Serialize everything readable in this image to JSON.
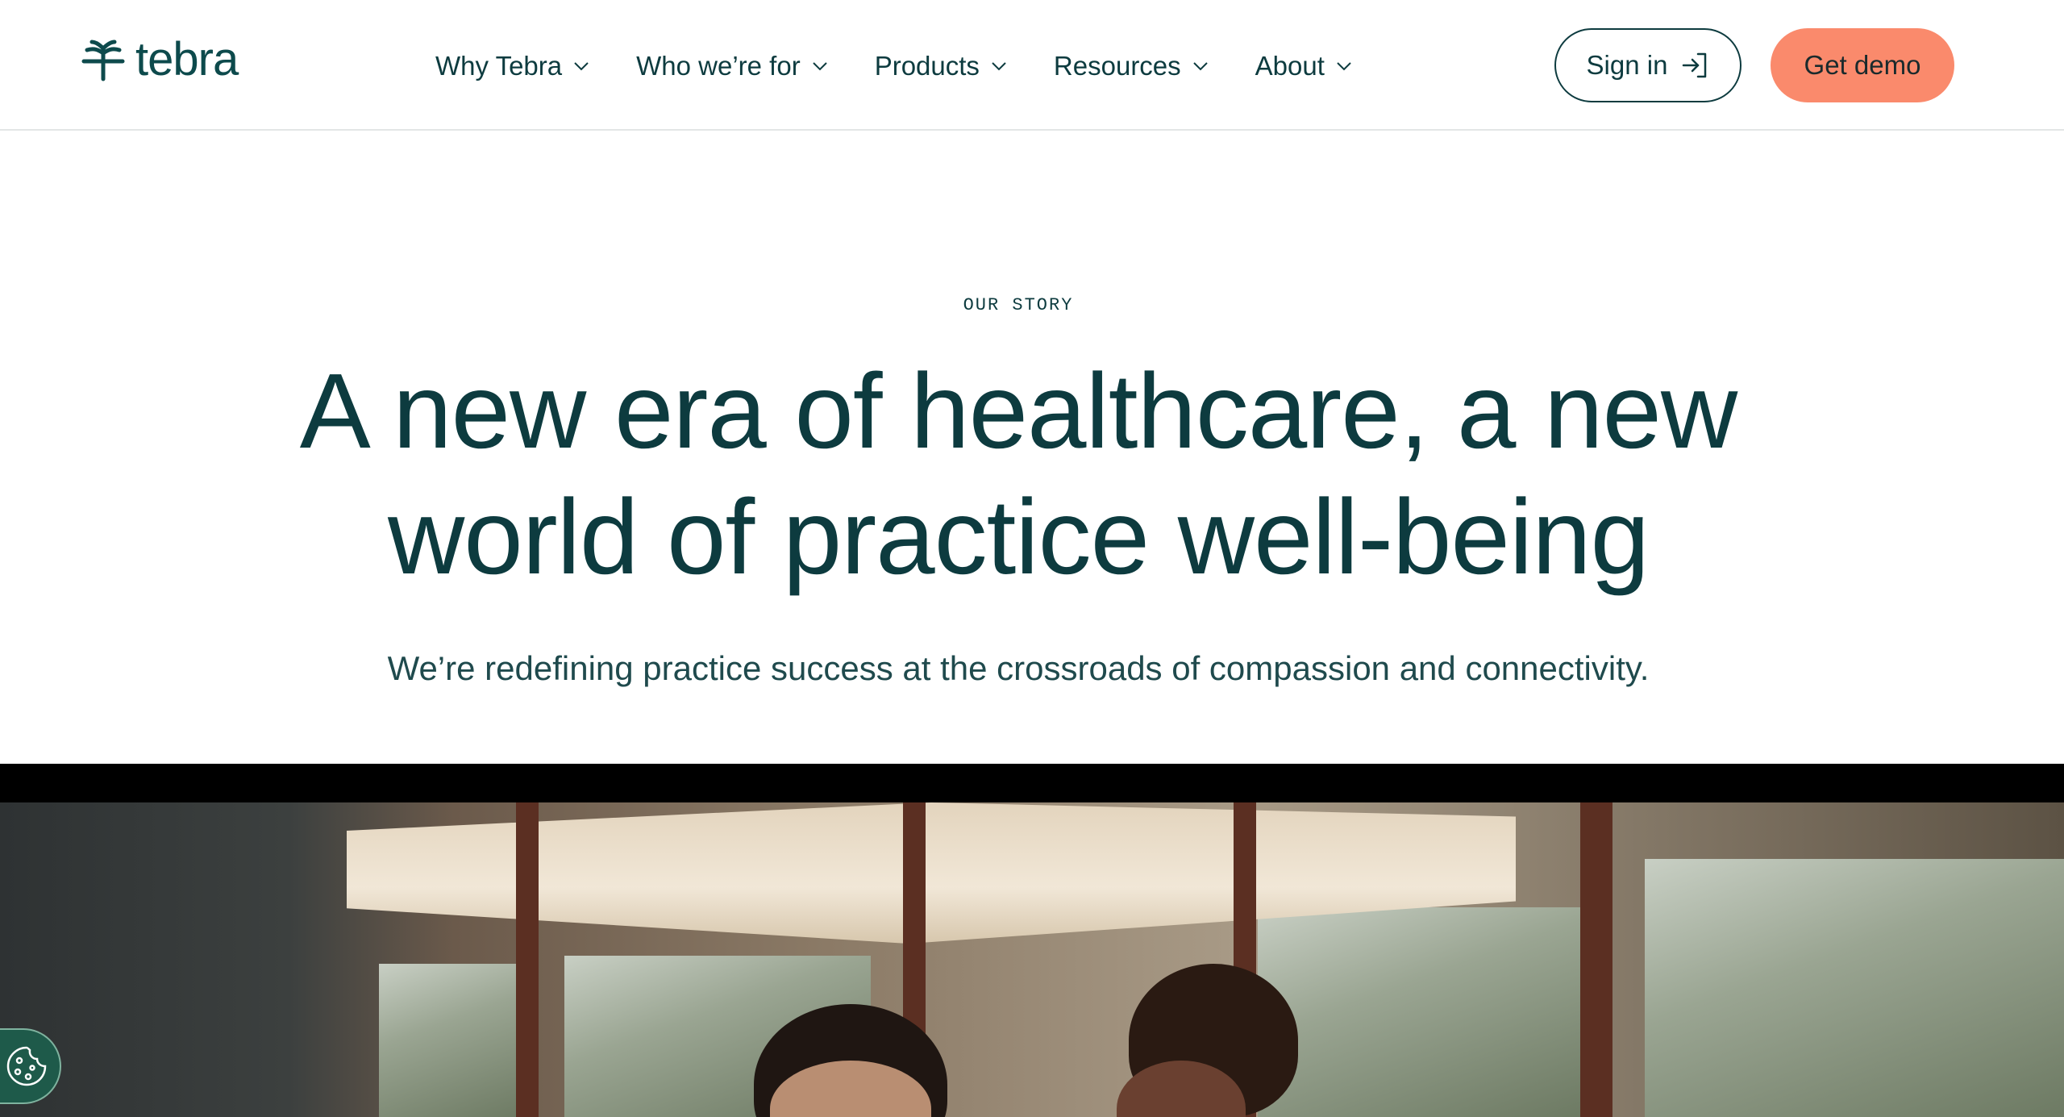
{
  "brand": {
    "name": "tebra",
    "logo_icon": "tebra-sprout-icon"
  },
  "nav": {
    "items": [
      {
        "label": "Why Tebra"
      },
      {
        "label": "Who we’re for"
      },
      {
        "label": "Products"
      },
      {
        "label": "Resources"
      },
      {
        "label": "About"
      }
    ]
  },
  "actions": {
    "signin_label": "Sign in",
    "demo_label": "Get demo"
  },
  "hero": {
    "eyebrow": "OUR STORY",
    "headline_line1": "A new era of healthcare, a new",
    "headline_line2": "world of practice well-being",
    "subhead": "We’re redefining practice success at the crossroads of compassion and connectivity."
  },
  "colors": {
    "brand_teal": "#0d3b3f",
    "demo_button": "#fa8a6c",
    "cookie_button": "#1e5a4a"
  },
  "cookie": {
    "icon": "cookie-icon"
  }
}
